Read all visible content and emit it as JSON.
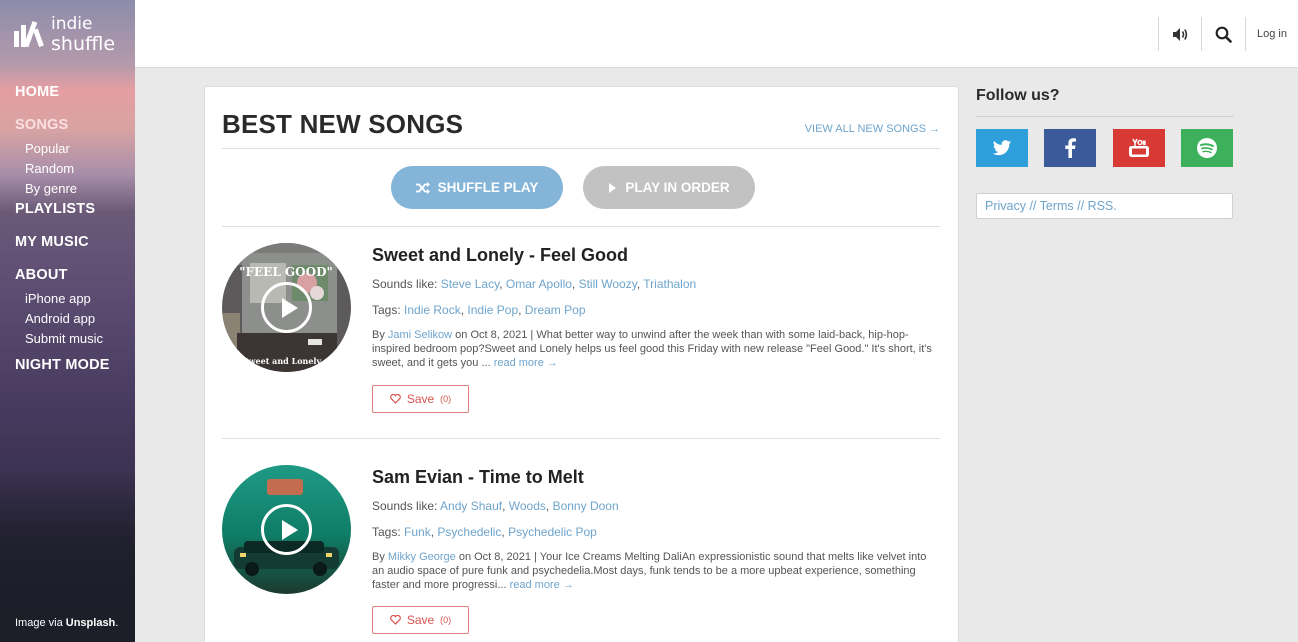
{
  "brand": {
    "line1": "indie",
    "line2": "shuffle"
  },
  "sidebar": {
    "nav": [
      {
        "label": "HOME"
      },
      {
        "label": "SONGS",
        "children": [
          "Popular",
          "Random",
          "By genre"
        ]
      },
      {
        "label": "PLAYLISTS"
      },
      {
        "label": "MY MUSIC"
      },
      {
        "label": "ABOUT",
        "children": [
          "iPhone app",
          "Android app",
          "Submit music"
        ]
      },
      {
        "label": "NIGHT MODE"
      }
    ],
    "credit_prefix": "Image via",
    "credit_source": "Unsplash",
    "credit_suffix": "."
  },
  "header": {
    "volume_icon": "volume-icon",
    "search_icon": "search-icon",
    "login_label": "Log in"
  },
  "main": {
    "title": "BEST NEW SONGS",
    "view_all": "VIEW ALL NEW SONGS →",
    "shuffle_label": "SHUFFLE PLAY",
    "order_label": "PLAY IN ORDER",
    "songs": [
      {
        "title": "Sweet and Lonely - Feel Good",
        "sounds_like_label": "Sounds like:",
        "sounds_like": [
          "Steve Lacy",
          "Omar Apollo",
          "Still Woozy",
          "Triathalon"
        ],
        "tags_label": "Tags:",
        "tags": [
          "Indie Rock",
          "Indie Pop",
          "Dream Pop"
        ],
        "by_label": "By",
        "author": "Jami Selikow",
        "date": "on Oct 8, 2021",
        "excerpt": "What better way to unwind after the week than with some laid-back, hip-hop-inspired bedroom pop?Sweet and Lonely helps us feel good this Friday with new release \"Feel Good.\" It's short, it's sweet, and it gets you ...",
        "read_more": "read more →",
        "save_label": "Save",
        "save_count": "(0)",
        "art_text_top": "\"FEEL GOOD\"",
        "art_text_bottom": "Sweet and Lonely"
      },
      {
        "title": "Sam Evian - Time to Melt",
        "sounds_like_label": "Sounds like:",
        "sounds_like": [
          "Andy Shauf",
          "Woods",
          "Bonny Doon"
        ],
        "tags_label": "Tags:",
        "tags": [
          "Funk",
          "Psychedelic",
          "Psychedelic Pop"
        ],
        "by_label": "By",
        "author": "Mikky George",
        "date": "on Oct 8, 2021",
        "excerpt": "Your Ice Creams Melting DaliAn expressionistic sound that melts like velvet into an audio space of pure funk and psychedelia.Most days, funk tends to be a more upbeat experience, something faster and more progressi...",
        "read_more": "read more →",
        "save_label": "Save",
        "save_count": "(0)"
      }
    ]
  },
  "aside": {
    "follow_title": "Follow us?",
    "social": [
      {
        "name": "twitter",
        "color": "#2f9fdc"
      },
      {
        "name": "facebook",
        "color": "#3b5a9a"
      },
      {
        "name": "youtube",
        "color": "#d73a35"
      },
      {
        "name": "spotify",
        "color": "#3cb05a"
      }
    ],
    "footer_links": "Privacy // Terms // RSS."
  },
  "colors": {
    "link": "#6ea4cc",
    "shuffle": "#84b5d9",
    "order": "#c2c2c2",
    "save": "#d9534f"
  }
}
